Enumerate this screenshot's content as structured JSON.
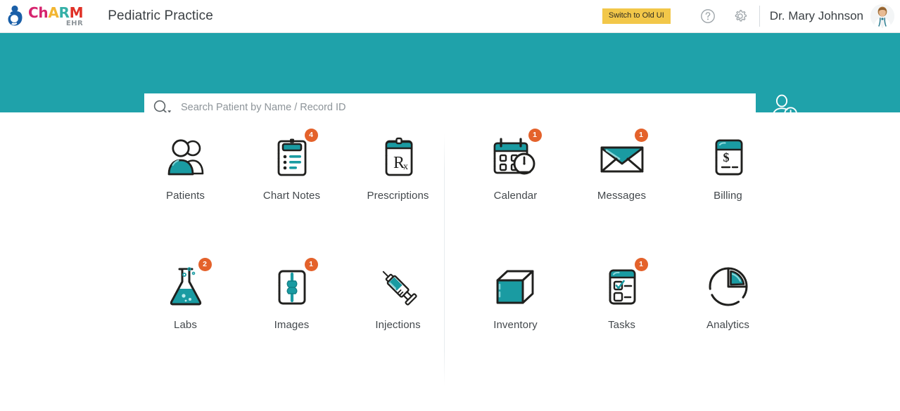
{
  "header": {
    "logo": {
      "name": "charm-ehr-logo",
      "wordmark_parts": [
        {
          "text": "C",
          "color": "#d6246e"
        },
        {
          "text": "h",
          "color": "#d6246e"
        },
        {
          "text": "A",
          "color": "#f2b632"
        },
        {
          "text": "R",
          "color": "#35b0a7"
        },
        {
          "text": "M",
          "color": "#e03127"
        }
      ],
      "subtext": "EHR"
    },
    "practice_title": "Pediatric Practice",
    "switch_old_ui_label": "Switch to Old UI",
    "help_icon": "question-circle-icon",
    "settings_icon": "gear-icon",
    "user_name": "Dr. Mary Johnson",
    "avatar_icon": "user-avatar-photo"
  },
  "search": {
    "placeholder": "Search Patient by Name / Record ID",
    "value": "",
    "search_icon": "magnifier-dropdown-icon",
    "add_patient_icon": "add-patient-icon"
  },
  "modules": {
    "left_row1": [
      {
        "label": "Patients",
        "icon": "patients-icon",
        "badge": ""
      },
      {
        "label": "Chart Notes",
        "icon": "chart-notes-icon",
        "badge": "4"
      },
      {
        "label": "Prescriptions",
        "icon": "prescriptions-icon",
        "badge": ""
      }
    ],
    "right_row1": [
      {
        "label": "Calendar",
        "icon": "calendar-icon",
        "badge": "1"
      },
      {
        "label": "Messages",
        "icon": "messages-icon",
        "badge": "1"
      },
      {
        "label": "Billing",
        "icon": "billing-icon",
        "badge": ""
      }
    ],
    "left_row2": [
      {
        "label": "Labs",
        "icon": "labs-flask-icon",
        "badge": "2"
      },
      {
        "label": "Images",
        "icon": "images-xray-icon",
        "badge": "1"
      },
      {
        "label": "Injections",
        "icon": "syringe-icon",
        "badge": ""
      }
    ],
    "right_row2": [
      {
        "label": "Inventory",
        "icon": "inventory-box-icon",
        "badge": ""
      },
      {
        "label": "Tasks",
        "icon": "tasks-icon",
        "badge": "1"
      },
      {
        "label": "Analytics",
        "icon": "analytics-pie-icon",
        "badge": ""
      }
    ]
  },
  "colors": {
    "banner_teal": "#1fa2aa",
    "icon_teal": "#17a2a8",
    "badge_orange": "#e4622b",
    "switch_button_gold": "#f2c749",
    "text_dark": "#43484c"
  }
}
